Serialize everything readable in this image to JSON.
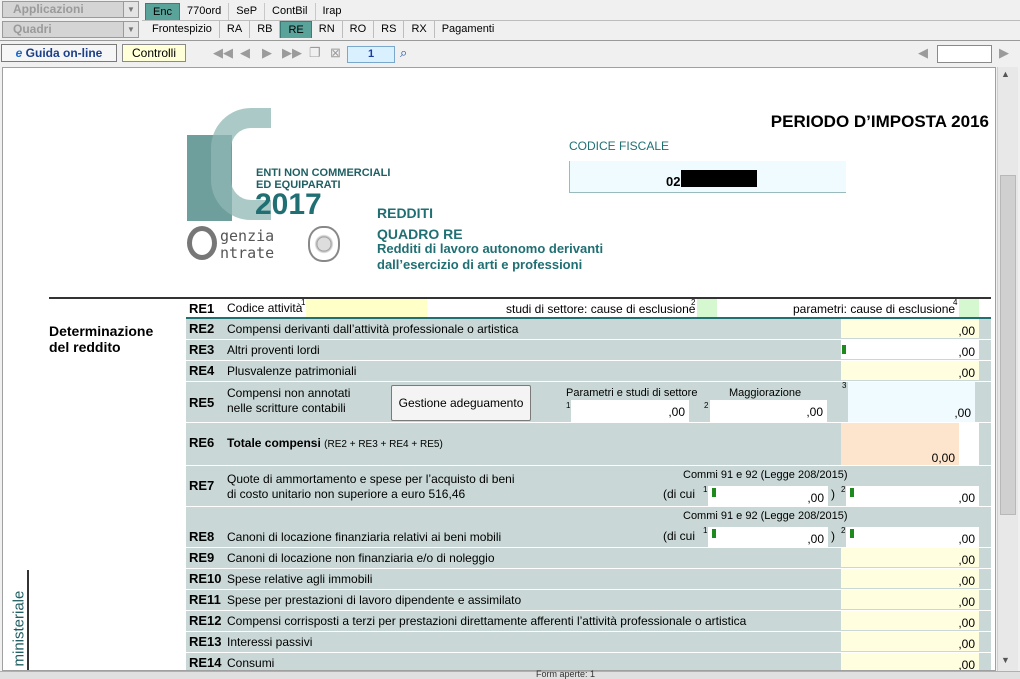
{
  "top": {
    "applicazioni": "Applicazioni",
    "quadri": "Quadri",
    "tabs1": [
      "Enc",
      "770ord",
      "SeP",
      "ContBil",
      "Irap"
    ],
    "tabs2": [
      "Frontespizio",
      "RA",
      "RB",
      "RE",
      "RN",
      "RO",
      "RS",
      "RX",
      "Pagamenti"
    ]
  },
  "toolbar": {
    "guida": "Guida on-line",
    "controlli": "Controlli",
    "page_number": "1"
  },
  "header": {
    "periodo": "PERIODO D’IMPOSTA 2016",
    "codice_fiscale_label": "CODICE FISCALE",
    "codice_fiscale_prefix": "02",
    "logo_line1": "ENTI NON COMMERCIALI",
    "logo_line2": "ED EQUIPARATI",
    "logo_year": "2017",
    "agenzia1": "genzia",
    "agenzia2": "ntrate",
    "redditi": "REDDITI",
    "quadro": "QUADRO RE",
    "descr1": "Redditi di lavoro autonomo derivanti",
    "descr2": "dall’esercizio di arti e professioni"
  },
  "section": {
    "title1": "Determinazione",
    "title2": "del reddito",
    "side": "ministeriale"
  },
  "re1": {
    "code": "RE1",
    "label": "Codice attività",
    "studi": "studi di settore: cause di esclusione",
    "parametri": "parametri: cause di esclusione"
  },
  "rows": {
    "re2": {
      "code": "RE2",
      "label": "Compensi derivanti dall’attività professionale o artistica",
      "value": ",00"
    },
    "re3": {
      "code": "RE3",
      "label": "Altri proventi lordi",
      "value": ",00"
    },
    "re4": {
      "code": "RE4",
      "label": "Plusvalenze patrimoniali",
      "value": ",00"
    },
    "re5": {
      "code": "RE5",
      "label1": "Compensi non annotati",
      "label2": "nelle scritture contabili",
      "button": "Gestione adeguamento",
      "col1": "Parametri e studi di settore",
      "col2": "Maggiorazione",
      "v1": ",00",
      "v2": ",00",
      "v3": ",00"
    },
    "re6": {
      "code": "RE6",
      "label": "Totale compensi",
      "formula": "(RE2 + RE3 + RE4 + RE5)",
      "value": "0,00"
    },
    "re7": {
      "code": "RE7",
      "label1": "Quote di ammortamento e spese per l’acquisto di beni",
      "label2": "di costo unitario non superiore a euro 516,46",
      "commi": "Commi 91 e 92 (Legge 208/2015)",
      "dicui": "(di cui",
      "v1": ",00",
      "v2": ",00"
    },
    "re8": {
      "code": "RE8",
      "label": "Canoni di locazione finanziaria relativi ai beni mobili",
      "commi": "Commi 91 e 92 (Legge 208/2015)",
      "dicui": "(di cui",
      "v1": ",00",
      "v2": ",00"
    },
    "re9": {
      "code": "RE9",
      "label": "Canoni di locazione non finanziaria e/o di noleggio",
      "value": ",00"
    },
    "re10": {
      "code": "RE10",
      "label": "Spese relative agli immobili",
      "value": ",00"
    },
    "re11": {
      "code": "RE11",
      "label": "Spese per prestazioni di lavoro dipendente e assimilato",
      "value": ",00"
    },
    "re12": {
      "code": "RE12",
      "label": "Compensi corrisposti a terzi per prestazioni direttamente afferenti l’attività professionale o artistica",
      "value": ",00"
    },
    "re13": {
      "code": "RE13",
      "label": "Interessi passivi",
      "value": ",00"
    },
    "re14": {
      "code": "RE14",
      "label": "Consumi",
      "value": ",00"
    }
  },
  "status": {
    "text": "Form aperte: 1"
  }
}
